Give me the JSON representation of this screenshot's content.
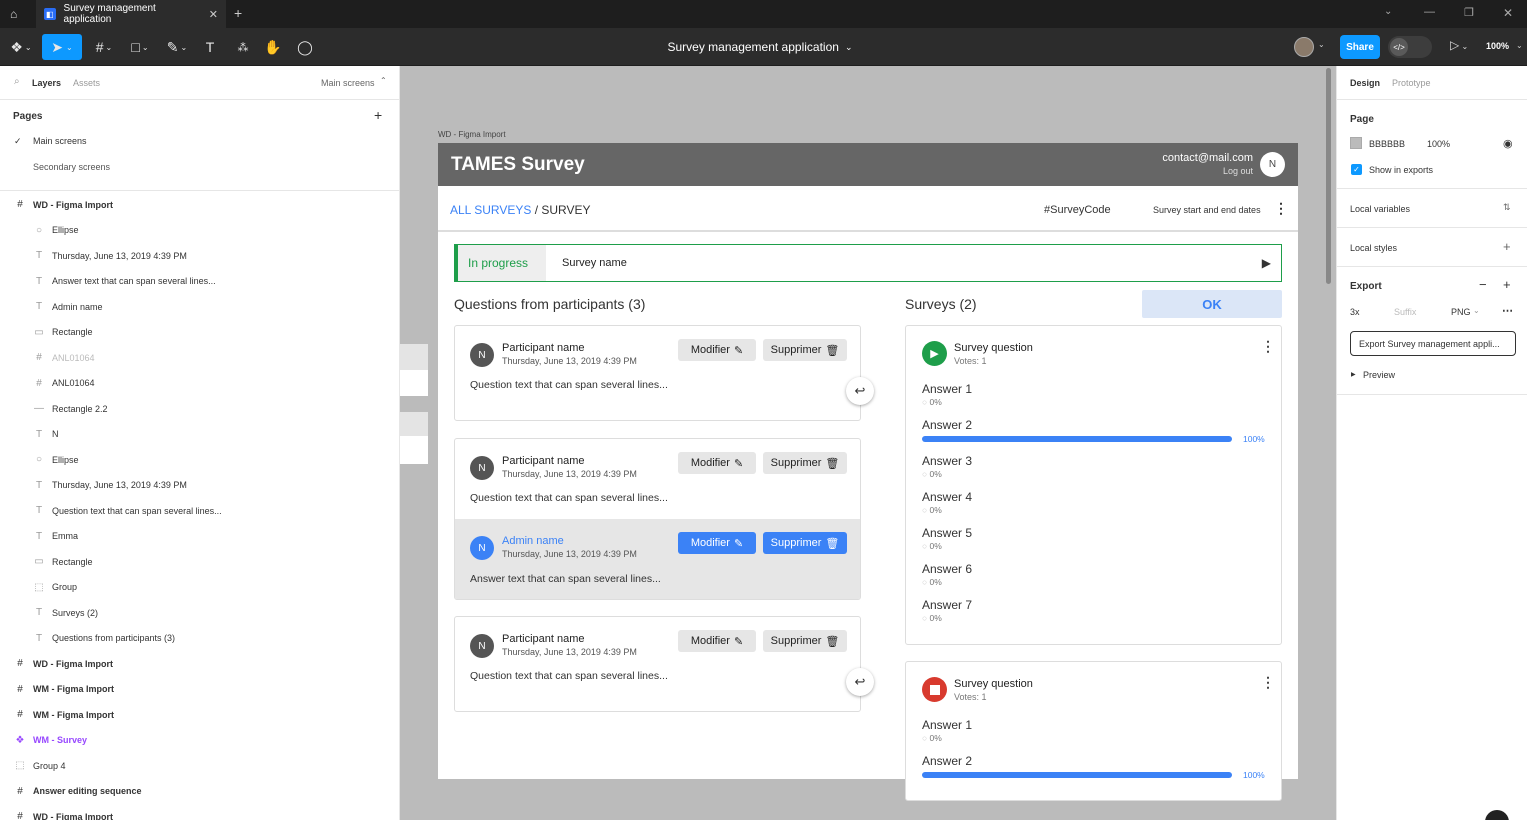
{
  "tab": {
    "title": "Survey management application"
  },
  "toolbar": {
    "title": "Survey management application",
    "share": "Share",
    "zoom": "100%"
  },
  "left": {
    "tabs": {
      "layers": "Layers",
      "assets": "Assets",
      "page_select": "Main screens"
    },
    "pages_title": "Pages",
    "pages": [
      "Main screens",
      "Secondary screens"
    ],
    "layers": [
      {
        "icon": "#",
        "label": "WD - Figma Import",
        "bold": true,
        "indent": false
      },
      {
        "icon": "○",
        "label": "Ellipse",
        "indent": true
      },
      {
        "icon": "T",
        "label": "Thursday, June 13, 2019 4:39 PM",
        "indent": true
      },
      {
        "icon": "T",
        "label": "Answer text that can span several lines...",
        "indent": true
      },
      {
        "icon": "T",
        "label": "Admin name",
        "indent": true
      },
      {
        "icon": "▭",
        "label": "Rectangle",
        "indent": true
      },
      {
        "icon": "#",
        "label": "ANL01064",
        "indent": true,
        "muted": true
      },
      {
        "icon": "#",
        "label": "ANL01064",
        "indent": true
      },
      {
        "icon": "—",
        "label": "Rectangle 2.2",
        "indent": true
      },
      {
        "icon": "T",
        "label": "N",
        "indent": true
      },
      {
        "icon": "○",
        "label": "Ellipse",
        "indent": true
      },
      {
        "icon": "T",
        "label": "Thursday, June 13, 2019 4:39 PM",
        "indent": true
      },
      {
        "icon": "T",
        "label": "Question text that can span several lines...",
        "indent": true
      },
      {
        "icon": "T",
        "label": "Emma",
        "indent": true
      },
      {
        "icon": "▭",
        "label": "Rectangle",
        "indent": true
      },
      {
        "icon": "⬚",
        "label": "Group",
        "indent": true
      },
      {
        "icon": "T",
        "label": "Surveys (2)",
        "indent": true
      },
      {
        "icon": "T",
        "label": "Questions from participants (3)",
        "indent": true
      },
      {
        "icon": "#",
        "label": "WD - Figma Import",
        "bold": true,
        "indent": false
      },
      {
        "icon": "#",
        "label": "WM - Figma Import",
        "bold": true,
        "indent": false
      },
      {
        "icon": "#",
        "label": "WM - Figma Import",
        "bold": true,
        "indent": false
      },
      {
        "icon": "❖",
        "label": "WM - Survey",
        "bold": true,
        "indent": false,
        "purple": true
      },
      {
        "icon": "⬚",
        "label": "Group 4",
        "indent": false
      },
      {
        "icon": "#",
        "label": "Answer editing sequence",
        "bold": true,
        "indent": false
      },
      {
        "icon": "#",
        "label": "WD - Figma Import",
        "bold": true,
        "indent": false
      }
    ]
  },
  "right": {
    "tabs": {
      "design": "Design",
      "prototype": "Prototype"
    },
    "page_title": "Page",
    "page_color": "BBBBBB",
    "page_opacity": "100%",
    "show_exports": "Show in exports",
    "local_variables": "Local variables",
    "local_styles": "Local styles",
    "export_title": "Export",
    "export_scale": "3x",
    "export_suffix": "Suffix",
    "export_format": "PNG",
    "export_button": "Export Survey management appli...",
    "preview": "Preview"
  },
  "canvas": {
    "frame_label": "WD - Figma Import",
    "app": {
      "brand": "TAMES Survey",
      "email": "contact@mail.com",
      "logout": "Log out",
      "user_initial": "N",
      "breadcrumb_link": "ALL SURVEYS",
      "breadcrumb_sep": " / ",
      "breadcrumb_current": "SURVEY",
      "survey_code": "#SurveyCode",
      "survey_dates": "Survey start and end dates",
      "status": "In progress",
      "survey_name": "Survey name",
      "questions_title": "Questions from participants (3)",
      "surveys_title": "Surveys (2)",
      "ok_label": "OK",
      "modify": "Modifier",
      "delete": "Supprimer",
      "questions": [
        {
          "initial": "N",
          "name": "Participant name",
          "date": "Thursday, June 13, 2019 4:39 PM",
          "text": "Question text that can span several lines..."
        },
        {
          "initial": "N",
          "name": "Participant name",
          "date": "Thursday, June 13, 2019 4:39 PM",
          "text": "Question text that can span several lines..."
        },
        {
          "initial": "N",
          "name": "Participant name",
          "date": "Thursday, June 13, 2019 4:39 PM",
          "text": "Question text that can span several lines..."
        }
      ],
      "admin_answer": {
        "initial": "N",
        "name": "Admin name",
        "date": "Thursday, June 13, 2019 4:39 PM",
        "text": "Answer text that can span several lines..."
      },
      "survey1": {
        "question": "Survey question",
        "votes": "Votes: 1",
        "answers": [
          {
            "label": "Answer 1",
            "pct": "0%",
            "fill": 0
          },
          {
            "label": "Answer 2",
            "pct": "100%",
            "fill": 1
          },
          {
            "label": "Answer 3",
            "pct": "0%",
            "fill": 0
          },
          {
            "label": "Answer 4",
            "pct": "0%",
            "fill": 0
          },
          {
            "label": "Answer 5",
            "pct": "0%",
            "fill": 0
          },
          {
            "label": "Answer 6",
            "pct": "0%",
            "fill": 0
          },
          {
            "label": "Answer 7",
            "pct": "0%",
            "fill": 0
          }
        ]
      },
      "survey2": {
        "question": "Survey question",
        "votes": "Votes: 1",
        "answers": [
          {
            "label": "Answer 1",
            "pct": "0%",
            "fill": 0
          },
          {
            "label": "Answer 2",
            "pct": "100%",
            "fill": 1
          }
        ]
      }
    }
  },
  "colors": {
    "accent": "#0d99ff",
    "app_blue": "#3b82f6",
    "status_green": "#1e9e4a",
    "stop_red": "#d83a2e",
    "canvas_bg": "#BBBBBB"
  }
}
